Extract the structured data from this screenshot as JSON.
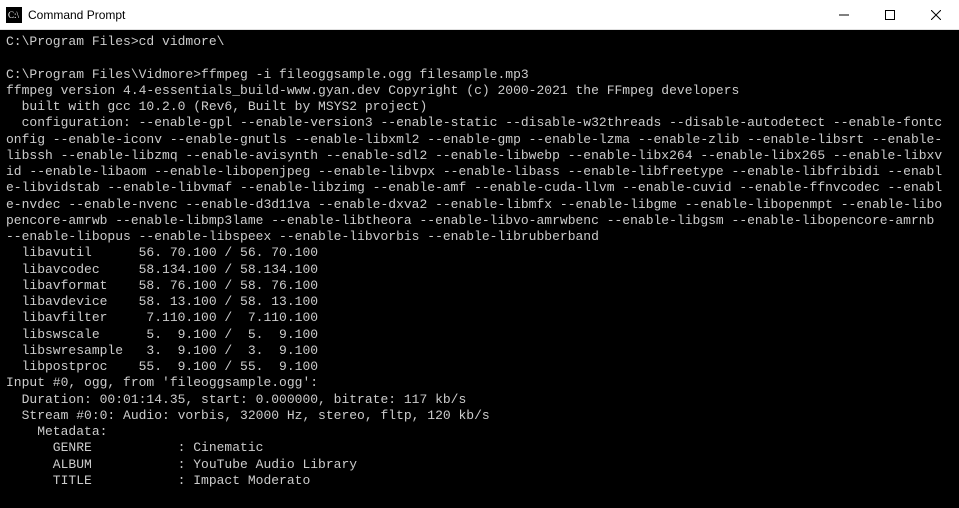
{
  "window": {
    "title": "Command Prompt"
  },
  "terminal": {
    "lines": [
      "C:\\Program Files>cd vidmore\\",
      "",
      "C:\\Program Files\\Vidmore>ffmpeg -i fileoggsample.ogg filesample.mp3",
      "ffmpeg version 4.4-essentials_build-www.gyan.dev Copyright (c) 2000-2021 the FFmpeg developers",
      "  built with gcc 10.2.0 (Rev6, Built by MSYS2 project)",
      "  configuration: --enable-gpl --enable-version3 --enable-static --disable-w32threads --disable-autodetect --enable-fontc",
      "onfig --enable-iconv --enable-gnutls --enable-libxml2 --enable-gmp --enable-lzma --enable-zlib --enable-libsrt --enable-",
      "libssh --enable-libzmq --enable-avisynth --enable-sdl2 --enable-libwebp --enable-libx264 --enable-libx265 --enable-libxv",
      "id --enable-libaom --enable-libopenjpeg --enable-libvpx --enable-libass --enable-libfreetype --enable-libfribidi --enabl",
      "e-libvidstab --enable-libvmaf --enable-libzimg --enable-amf --enable-cuda-llvm --enable-cuvid --enable-ffnvcodec --enabl",
      "e-nvdec --enable-nvenc --enable-d3d11va --enable-dxva2 --enable-libmfx --enable-libgme --enable-libopenmpt --enable-libo",
      "pencore-amrwb --enable-libmp3lame --enable-libtheora --enable-libvo-amrwbenc --enable-libgsm --enable-libopencore-amrnb ",
      "--enable-libopus --enable-libspeex --enable-libvorbis --enable-librubberband",
      "  libavutil      56. 70.100 / 56. 70.100",
      "  libavcodec     58.134.100 / 58.134.100",
      "  libavformat    58. 76.100 / 58. 76.100",
      "  libavdevice    58. 13.100 / 58. 13.100",
      "  libavfilter     7.110.100 /  7.110.100",
      "  libswscale      5.  9.100 /  5.  9.100",
      "  libswresample   3.  9.100 /  3.  9.100",
      "  libpostproc    55.  9.100 / 55.  9.100",
      "Input #0, ogg, from 'fileoggsample.ogg':",
      "  Duration: 00:01:14.35, start: 0.000000, bitrate: 117 kb/s",
      "  Stream #0:0: Audio: vorbis, 32000 Hz, stereo, fltp, 120 kb/s",
      "    Metadata:",
      "      GENRE           : Cinematic",
      "      ALBUM           : YouTube Audio Library",
      "      TITLE           : Impact Moderato"
    ]
  }
}
